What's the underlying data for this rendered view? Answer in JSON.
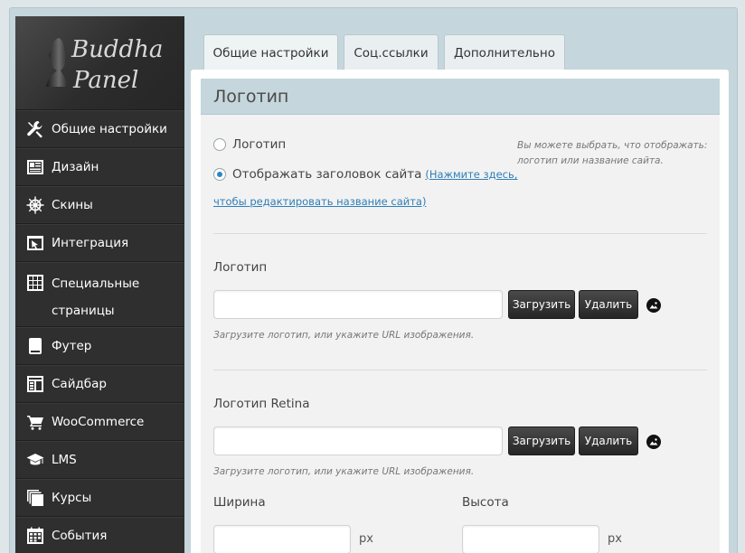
{
  "brand": {
    "line1": "Buddha",
    "line2": "Panel"
  },
  "sidebar": {
    "items": [
      {
        "label": "Общие настройки",
        "icon": "wrench-icon"
      },
      {
        "label": "Дизайн",
        "icon": "layout-icon"
      },
      {
        "label": "Скины",
        "icon": "ship-wheel-icon"
      },
      {
        "label": "Интеграция",
        "icon": "window-cursor-icon"
      },
      {
        "label": "Специальные страницы",
        "icon": "grid-icon"
      },
      {
        "label": "Футер",
        "icon": "footer-icon"
      },
      {
        "label": "Сайдбар",
        "icon": "sidebar-icon"
      },
      {
        "label": "WooCommerce",
        "icon": "cart-icon"
      },
      {
        "label": "LMS",
        "icon": "graduation-cap-icon"
      },
      {
        "label": "Курсы",
        "icon": "stack-icon"
      },
      {
        "label": "События",
        "icon": "calendar-icon"
      }
    ]
  },
  "tabs": [
    {
      "label": "Общие настройки"
    },
    {
      "label": "Соц.ссылки"
    },
    {
      "label": "Дополнительно"
    }
  ],
  "section": {
    "title": "Логотип",
    "radio_logo": "Логотип",
    "radio_title": "Отображать заголовок сайта",
    "link_part1": "(Нажмите здесь,",
    "link_part2": "чтобы редактировать название сайта)",
    "hint_line1": "Вы можете выбрать, что отображать:",
    "hint_line2": "логотип или название сайта.",
    "logo": {
      "label": "Логотип",
      "value": "",
      "upload": "Загрузить",
      "delete": "Удалить",
      "hint": "Загрузите логотип, или укажите URL изображения."
    },
    "retina": {
      "label": "Логотип Retina",
      "value": "",
      "upload": "Загрузить",
      "delete": "Удалить",
      "hint": "Загрузите логотип, или укажите URL изображения."
    },
    "width": {
      "label": "Ширина",
      "value": "",
      "unit": "px"
    },
    "height": {
      "label": "Высота",
      "value": "",
      "unit": "px"
    }
  },
  "colors": {
    "sidebar_bg": "#2f2f2f",
    "header_bg": "#c5d6dc",
    "link": "#2f7fb8",
    "radio_active": "#2b86c5"
  }
}
